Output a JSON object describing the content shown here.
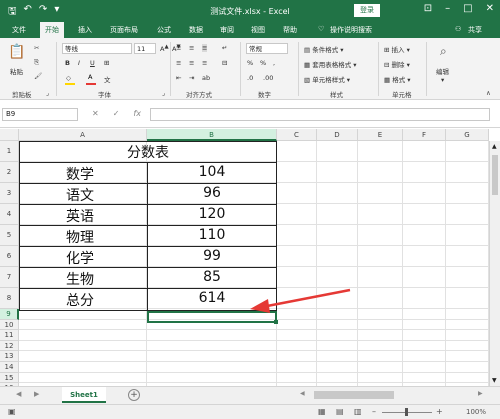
{
  "titlebar": {
    "title": "测试文件.xlsx - Excel",
    "login": "登录",
    "save_icon": "save-icon",
    "undo_icon": "undo-icon",
    "redo_icon": "redo-icon"
  },
  "tabs": [
    "文件",
    "开始",
    "插入",
    "页面布局",
    "公式",
    "数据",
    "审阅",
    "视图",
    "帮助",
    "操作说明搜索",
    "共享"
  ],
  "ribbon": {
    "paste": "粘贴",
    "font_name": "等线",
    "font_size": "11",
    "groups": {
      "clipboard": "剪贴板",
      "font": "字体",
      "align": "对齐方式",
      "number": "数字",
      "styles": "样式",
      "cells": "单元格",
      "edit": "编辑"
    },
    "number_format": "常规",
    "styles_items": [
      "条件格式",
      "套用表格格式",
      "单元格样式"
    ],
    "cells_items": [
      "插入",
      "删除",
      "格式"
    ],
    "edit_label": "编辑"
  },
  "formula_bar": {
    "name_box": "B9",
    "formula": "",
    "cancel": "✕",
    "enter": "✓",
    "fx": "fx"
  },
  "columns": [
    "A",
    "B",
    "C",
    "D",
    "E",
    "F",
    "G"
  ],
  "rows": [
    "1",
    "2",
    "3",
    "4",
    "5",
    "6",
    "7",
    "8",
    "9",
    "10",
    "11",
    "12",
    "13",
    "14",
    "15",
    "16"
  ],
  "sheet": {
    "title": "分数表",
    "records": [
      {
        "subject": "数学",
        "score": "104"
      },
      {
        "subject": "语文",
        "score": "96"
      },
      {
        "subject": "英语",
        "score": "120"
      },
      {
        "subject": "物理",
        "score": "110"
      },
      {
        "subject": "化学",
        "score": "99"
      },
      {
        "subject": "生物",
        "score": "85"
      },
      {
        "subject": "总分",
        "score": "614"
      }
    ]
  },
  "sheet_tabs": [
    "Sheet1"
  ],
  "status": {
    "zoom": "100%"
  },
  "colors": {
    "excel_green": "#217346",
    "arrow_red": "#e53935"
  }
}
